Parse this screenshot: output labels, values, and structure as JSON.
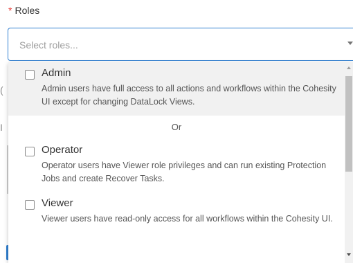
{
  "field": {
    "required_mark": "*",
    "label": "Roles"
  },
  "select": {
    "placeholder": "Select roles..."
  },
  "background_fragments": {
    "a": "(",
    "b": "I"
  },
  "dropdown": {
    "separator": "Or",
    "options": [
      {
        "title": "Admin",
        "description": "Admin users have full access to all actions and workflows within the Cohesity UI except for changing DataLock Views.",
        "checked": false,
        "highlighted": true
      },
      {
        "title": "Operator",
        "description": "Operator users have Viewer role privileges and can run existing Protection Jobs and create Recover Tasks.",
        "checked": false,
        "highlighted": false
      },
      {
        "title": "Viewer",
        "description": "Viewer users have read-only access for all workflows within the Cohesity UI.",
        "checked": false,
        "highlighted": false
      }
    ]
  },
  "colors": {
    "accent": "#2f7fd1",
    "required": "#e53935",
    "highlight_bg": "#f1f1f1"
  },
  "icons": {
    "select_arrow": "caret-down-icon",
    "scroll_up": "scroll-up-arrow-icon",
    "scroll_down": "scroll-down-arrow-icon",
    "checkbox": "checkbox-unchecked-icon"
  }
}
